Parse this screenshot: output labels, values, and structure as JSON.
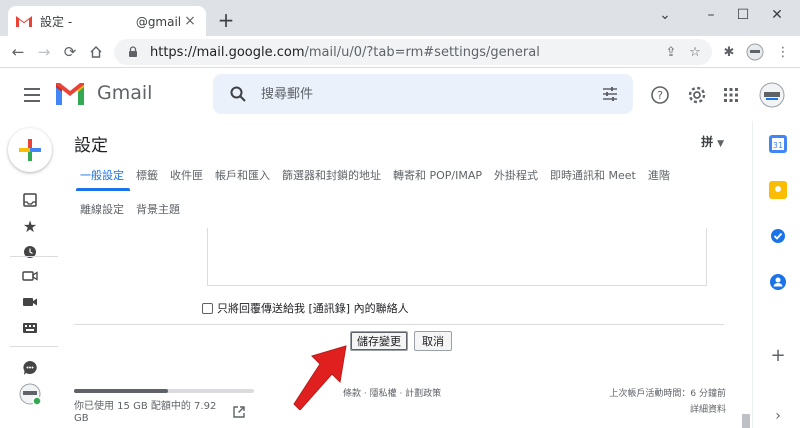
{
  "browser": {
    "tab": {
      "title": "設定 -",
      "email": "@gmail.co",
      "close": "×"
    },
    "new_tab": "+",
    "window": {
      "minimize": "⌄",
      "min": "–",
      "max": "☐",
      "close": "✕"
    },
    "url_host": "https://mail.google.com",
    "url_rest": "/mail/u/0/?tab=rm#settings/general"
  },
  "gmail": {
    "brand": "Gmail",
    "search_placeholder": "搜尋郵件"
  },
  "settings": {
    "title": "設定",
    "ime": "拼",
    "tabs": [
      "一般設定",
      "標籤",
      "收件匣",
      "帳戶和匯入",
      "篩選器和封鎖的地址",
      "轉寄和 POP/IMAP",
      "外掛程式",
      "即時通訊和 Meet",
      "進階"
    ],
    "tabs2": [
      "離線設定",
      "背景主題"
    ],
    "checkbox_label": "只將回覆傳送給我 [通訊錄] 內的聯絡人",
    "save_label": "儲存變更",
    "cancel_label": "取消"
  },
  "footer": {
    "storage_fraction": 0.52,
    "storage_text": "你已使用 15 GB 配額中的 7.92 GB",
    "policy": "條款 · 隱私權 · 計劃政策",
    "last_activity": "上次帳戶活動時間：6 分鐘前",
    "details": "詳細資料"
  },
  "colors": {
    "accent": "#1a73e8",
    "arrow": "#e0201f",
    "gmail_red": "#ea4335",
    "gmail_blue": "#4285f4",
    "gmail_yellow": "#fbbc04",
    "gmail_green": "#34a853"
  }
}
